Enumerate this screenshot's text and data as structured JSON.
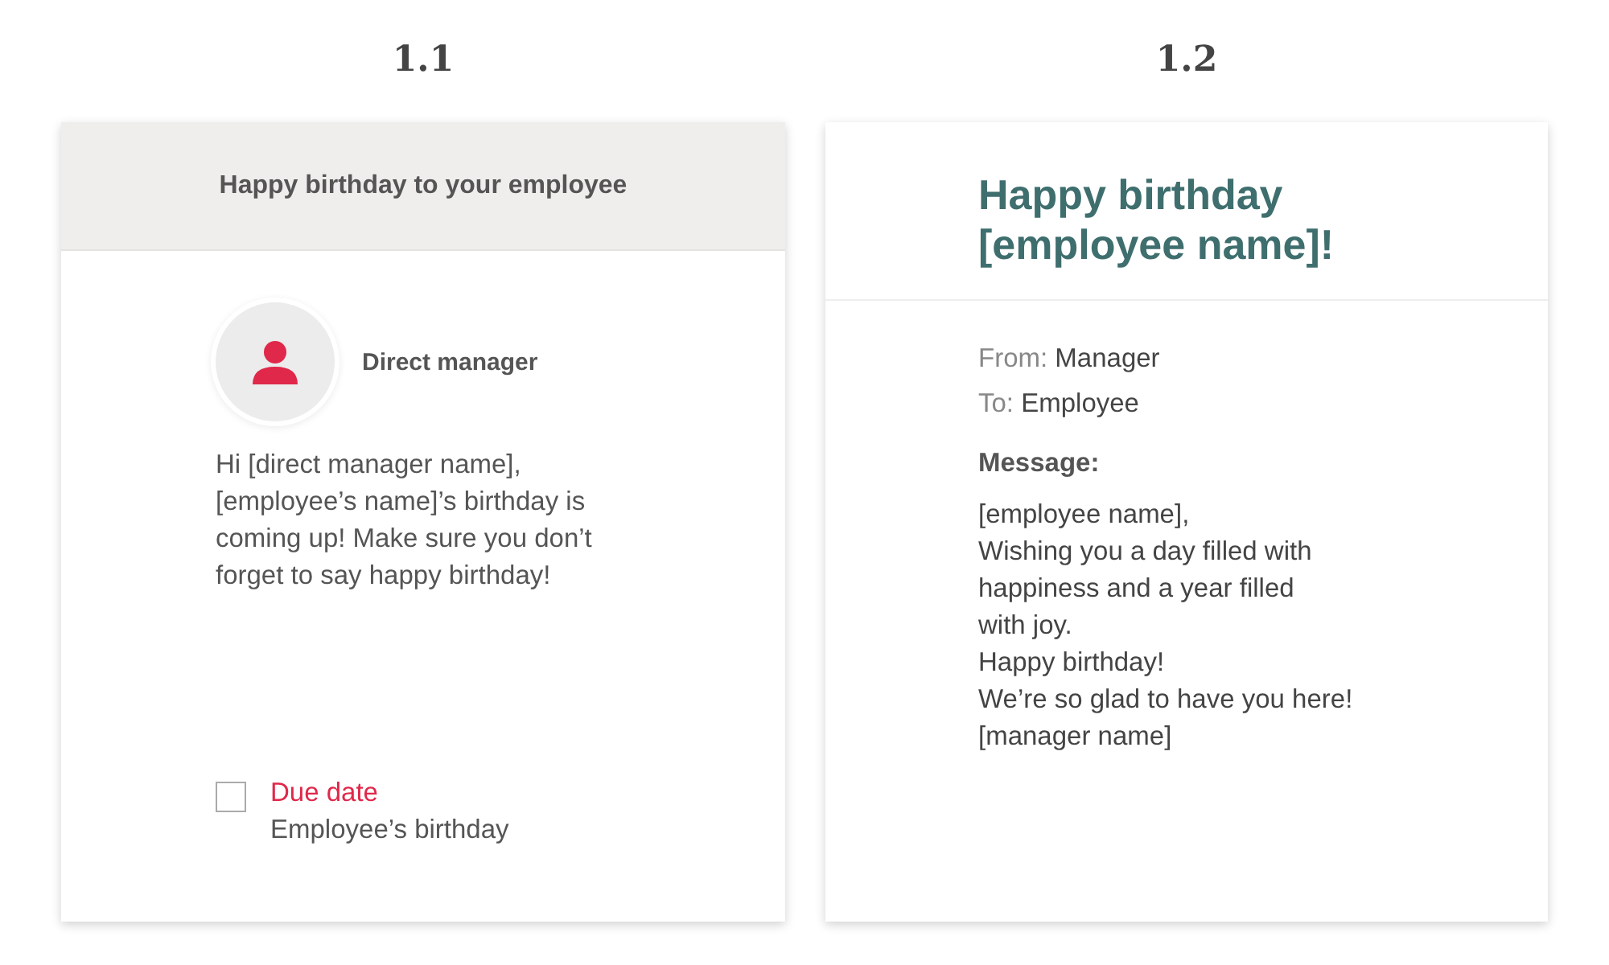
{
  "panels": [
    {
      "label": "1.1",
      "header": "Happy birthday to your employee",
      "sender": "Direct manager",
      "message": "Hi [direct manager name], [employee’s name]’s birthday is coming up! Make sure you don’t forget to say happy birthday!",
      "task": {
        "label": "Due date",
        "detail": "Employee’s birthday",
        "checked": false
      }
    },
    {
      "label": "1.2",
      "title_lines": [
        "Happy birthday",
        "[employee name]!"
      ],
      "from": {
        "label": "From:",
        "value": "Manager"
      },
      "to": {
        "label": "To:",
        "value": "Employee"
      },
      "message_label": "Message:",
      "message_lines": [
        "[employee name],",
        "Wishing you a day filled with",
        "happiness and a year filled",
        "with joy.",
        "Happy birthday!",
        "We’re so glad to have you here!",
        "[manager name]"
      ]
    }
  ]
}
